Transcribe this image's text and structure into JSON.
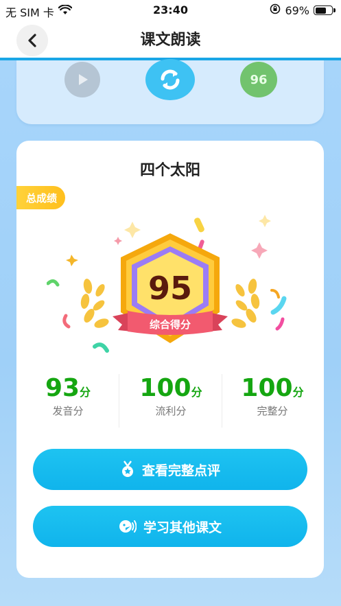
{
  "status_bar": {
    "carrier": "无 SIM 卡",
    "time": "23:40",
    "battery_text": "69%",
    "battery_level": 0.69
  },
  "nav": {
    "title": "课文朗读",
    "back_icon": "chevron-left-icon"
  },
  "player": {
    "play_icon": "play-icon",
    "replay_icon": "refresh-icon",
    "score_text": "96"
  },
  "result": {
    "lesson_title": "四个太阳",
    "total_tag": "总成绩",
    "overall_score": "95",
    "overall_label": "综合得分",
    "stats": [
      {
        "value": "93",
        "unit": "分",
        "label": "发音分"
      },
      {
        "value": "100",
        "unit": "分",
        "label": "流利分"
      },
      {
        "value": "100",
        "unit": "分",
        "label": "完整分"
      }
    ],
    "buttons": {
      "review_label": "查看完整点评",
      "other_label": "学习其他课文"
    }
  },
  "colors": {
    "accent": "#1aa6e6",
    "button": "#14b8ee",
    "score_green": "#15a611",
    "tag_yellow": "#ffc72b"
  }
}
